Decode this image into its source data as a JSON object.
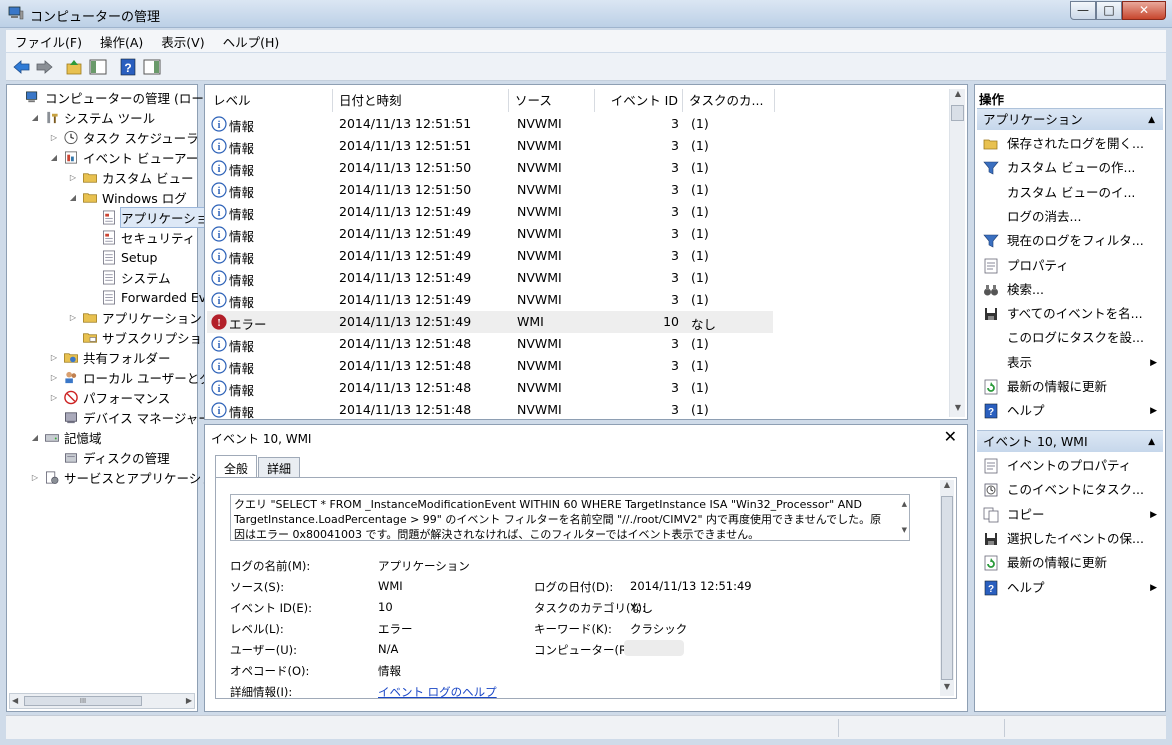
{
  "window": {
    "title": "コンピューターの管理",
    "buttons": {
      "minimize": "—",
      "maximize": "□",
      "close": "✕"
    }
  },
  "menu": [
    "ファイル(F)",
    "操作(A)",
    "表示(V)",
    "ヘルプ(H)"
  ],
  "tree": {
    "items": [
      {
        "label": "コンピューターの管理 (ローカ",
        "level": 0,
        "expander": ""
      },
      {
        "label": "システム ツール",
        "level": 1,
        "expander": "◢"
      },
      {
        "label": "タスク スケジューラ",
        "level": 2,
        "expander": "▷"
      },
      {
        "label": "イベント ビューアー",
        "level": 2,
        "expander": "◢"
      },
      {
        "label": "カスタム ビュー",
        "level": 3,
        "expander": "▷"
      },
      {
        "label": "Windows ログ",
        "level": 3,
        "expander": "◢"
      },
      {
        "label": "アプリケーション",
        "level": 4,
        "expander": "",
        "selected": true
      },
      {
        "label": "セキュリティ",
        "level": 4,
        "expander": ""
      },
      {
        "label": "Setup",
        "level": 4,
        "expander": ""
      },
      {
        "label": "システム",
        "level": 4,
        "expander": ""
      },
      {
        "label": "Forwarded Eve",
        "level": 4,
        "expander": ""
      },
      {
        "label": "アプリケーションと",
        "level": 3,
        "expander": "▷"
      },
      {
        "label": "サブスクリプション",
        "level": 3,
        "expander": ""
      },
      {
        "label": "共有フォルダー",
        "level": 2,
        "expander": "▷"
      },
      {
        "label": "ローカル ユーザーとグ",
        "level": 2,
        "expander": "▷"
      },
      {
        "label": "パフォーマンス",
        "level": 2,
        "expander": "▷"
      },
      {
        "label": "デバイス マネージャー",
        "level": 2,
        "expander": ""
      },
      {
        "label": "記憶域",
        "level": 1,
        "expander": "◢"
      },
      {
        "label": "ディスクの管理",
        "level": 2,
        "expander": ""
      },
      {
        "label": "サービスとアプリケーショ",
        "level": 1,
        "expander": "▷"
      }
    ],
    "scroll_thumb": "III"
  },
  "list": {
    "columns": [
      "レベル",
      "日付と時刻",
      "ソース",
      "イベント ID",
      "タスクのカ..."
    ],
    "rows": [
      {
        "level": "情報",
        "type": "info",
        "datetime": "2014/11/13 12:51:51",
        "source": "NVWMI",
        "id": "3",
        "task": "(1)"
      },
      {
        "level": "情報",
        "type": "info",
        "datetime": "2014/11/13 12:51:51",
        "source": "NVWMI",
        "id": "3",
        "task": "(1)"
      },
      {
        "level": "情報",
        "type": "info",
        "datetime": "2014/11/13 12:51:50",
        "source": "NVWMI",
        "id": "3",
        "task": "(1)"
      },
      {
        "level": "情報",
        "type": "info",
        "datetime": "2014/11/13 12:51:50",
        "source": "NVWMI",
        "id": "3",
        "task": "(1)"
      },
      {
        "level": "情報",
        "type": "info",
        "datetime": "2014/11/13 12:51:49",
        "source": "NVWMI",
        "id": "3",
        "task": "(1)"
      },
      {
        "level": "情報",
        "type": "info",
        "datetime": "2014/11/13 12:51:49",
        "source": "NVWMI",
        "id": "3",
        "task": "(1)"
      },
      {
        "level": "情報",
        "type": "info",
        "datetime": "2014/11/13 12:51:49",
        "source": "NVWMI",
        "id": "3",
        "task": "(1)"
      },
      {
        "level": "情報",
        "type": "info",
        "datetime": "2014/11/13 12:51:49",
        "source": "NVWMI",
        "id": "3",
        "task": "(1)"
      },
      {
        "level": "情報",
        "type": "info",
        "datetime": "2014/11/13 12:51:49",
        "source": "NVWMI",
        "id": "3",
        "task": "(1)"
      },
      {
        "level": "エラー",
        "type": "error",
        "datetime": "2014/11/13 12:51:49",
        "source": "WMI",
        "id": "10",
        "task": "なし"
      },
      {
        "level": "情報",
        "type": "info",
        "datetime": "2014/11/13 12:51:48",
        "source": "NVWMI",
        "id": "3",
        "task": "(1)"
      },
      {
        "level": "情報",
        "type": "info",
        "datetime": "2014/11/13 12:51:48",
        "source": "NVWMI",
        "id": "3",
        "task": "(1)"
      },
      {
        "level": "情報",
        "type": "info",
        "datetime": "2014/11/13 12:51:48",
        "source": "NVWMI",
        "id": "3",
        "task": "(1)"
      },
      {
        "level": "情報",
        "type": "info",
        "datetime": "2014/11/13 12:51:48",
        "source": "NVWMI",
        "id": "3",
        "task": "(1)"
      }
    ]
  },
  "detail": {
    "title": "イベント 10, WMI",
    "close": "✕",
    "tabs": [
      "全般",
      "詳細"
    ],
    "description": "クエリ \"SELECT * FROM _InstanceModificationEvent WITHIN 60 WHERE TargetInstance ISA \"Win32_Processor\" AND TargetInstance.LoadPercentage > 99\" のイベント フィルターを名前空間 \"//./root/CIMV2\" 内で再度使用できませんでした。原因はエラー 0x80041003 です。問題が解決されなければ、このフィルターではイベント表示できません。",
    "props": {
      "log_name_label": "ログの名前(M):",
      "log_name": "アプリケーション",
      "source_label": "ソース(S):",
      "source": "WMI",
      "logged_label": "ログの日付(D):",
      "logged": "2014/11/13 12:51:49",
      "event_id_label": "イベント ID(E):",
      "event_id": "10",
      "task_cat_label": "タスクのカテゴリ(Y):",
      "task_cat": "なし",
      "level_label": "レベル(L):",
      "level": "エラー",
      "keywords_label": "キーワード(K):",
      "keywords": "クラシック",
      "user_label": "ユーザー(U):",
      "user": "N/A",
      "computer_label": "コンピューター(R):",
      "opcode_label": "オペコード(O):",
      "opcode": "情報",
      "more_info_label": "詳細情報(I):",
      "more_info_link": "イベント ログのヘルプ"
    }
  },
  "actions": {
    "header": "操作",
    "section1": "アプリケーション",
    "items1": [
      {
        "label": "保存されたログを開く...",
        "icon": "folder-open-icon",
        "arrow": false
      },
      {
        "label": "カスタム ビューの作...",
        "icon": "filter-icon",
        "arrow": false
      },
      {
        "label": "カスタム ビューのイ...",
        "icon": "",
        "arrow": false
      },
      {
        "label": "ログの消去...",
        "icon": "",
        "arrow": false
      },
      {
        "label": "現在のログをフィルタ...",
        "icon": "filter-icon",
        "arrow": false
      },
      {
        "label": "プロパティ",
        "icon": "properties-icon",
        "arrow": false
      },
      {
        "label": "検索...",
        "icon": "binoculars-icon",
        "arrow": false
      },
      {
        "label": "すべてのイベントを名...",
        "icon": "save-icon",
        "arrow": false
      },
      {
        "label": "このログにタスクを設...",
        "icon": "",
        "arrow": false
      },
      {
        "label": "表示",
        "icon": "",
        "arrow": true
      },
      {
        "label": "最新の情報に更新",
        "icon": "refresh-icon",
        "arrow": false
      },
      {
        "label": "ヘルプ",
        "icon": "help-icon",
        "arrow": true
      }
    ],
    "section2": "イベント 10, WMI",
    "items2": [
      {
        "label": "イベントのプロパティ",
        "icon": "properties-icon",
        "arrow": false
      },
      {
        "label": "このイベントにタスク...",
        "icon": "task-icon",
        "arrow": false
      },
      {
        "label": "コピー",
        "icon": "copy-icon",
        "arrow": true
      },
      {
        "label": "選択したイベントの保...",
        "icon": "save-icon",
        "arrow": false
      },
      {
        "label": "最新の情報に更新",
        "icon": "refresh-icon",
        "arrow": false
      },
      {
        "label": "ヘルプ",
        "icon": "help-icon",
        "arrow": true
      }
    ]
  },
  "colors": {
    "info": "#2d62b8",
    "error": "#b3202a",
    "section_bg": "#cfdfee",
    "link": "#1a47c6"
  }
}
